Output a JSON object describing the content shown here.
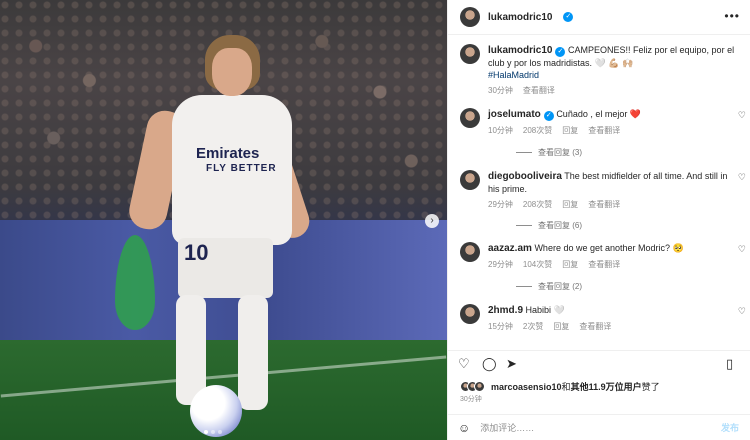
{
  "post": {
    "username": "lukamodric10",
    "more_icon": "more-horizontal-icon",
    "next_icon": "chevron-right-icon"
  },
  "photo": {
    "jersey_number": "10",
    "sponsor_line1": "Emirates",
    "sponsor_line2": "FLY BETTER"
  },
  "caption": {
    "username": "lukamodric10",
    "text": "CAMPEONES!! Feliz por el equipo, por el club y por los madridistas. 🤍 💪🏼 🙌🏼",
    "hashtag": "#HalaMadrid",
    "time": "30分钟",
    "translate": "查看翻译"
  },
  "comments": [
    {
      "username": "joselumato",
      "text": "Cuñado , el mejor ❤️",
      "time": "10分钟",
      "likes": "208次赞",
      "reply": "回复",
      "translate": "查看翻译",
      "view_replies": "查看回复 (3)"
    },
    {
      "username": "diegobooliveira",
      "text": "The best midfielder of all time. And still in his prime.",
      "time": "29分钟",
      "likes": "208次赞",
      "reply": "回复",
      "translate": "查看翻译",
      "view_replies": "查看回复 (6)"
    },
    {
      "username": "aazaz.am",
      "text": "Where do we get another Modric? 🥺",
      "time": "29分钟",
      "likes": "104次赞",
      "reply": "回复",
      "translate": "查看翻译",
      "view_replies": "查看回复 (2)"
    },
    {
      "username": "2hmd.9",
      "text": "Habibi 🤍",
      "time": "15分钟",
      "likes": "2次赞",
      "reply": "回复",
      "translate": "查看翻译"
    }
  ],
  "actions": {
    "like_icon": "heart-icon",
    "comment_icon": "comment-icon",
    "share_icon": "paper-plane-icon",
    "save_icon": "bookmark-icon"
  },
  "likes_summary": {
    "user": "marcoasensio10",
    "middle": "和",
    "others": "其他11.9万位用户",
    "suffix": "赞了"
  },
  "post_time": "30分钟",
  "add_comment": {
    "placeholder": "添加评论……",
    "publish": "发布",
    "emoji_icon": "smiley-icon"
  },
  "colors": {
    "link": "#00376b",
    "verified": "#0095f6",
    "publish_disabled": "#b2dffc",
    "secondary_text": "#8e8e8e"
  }
}
